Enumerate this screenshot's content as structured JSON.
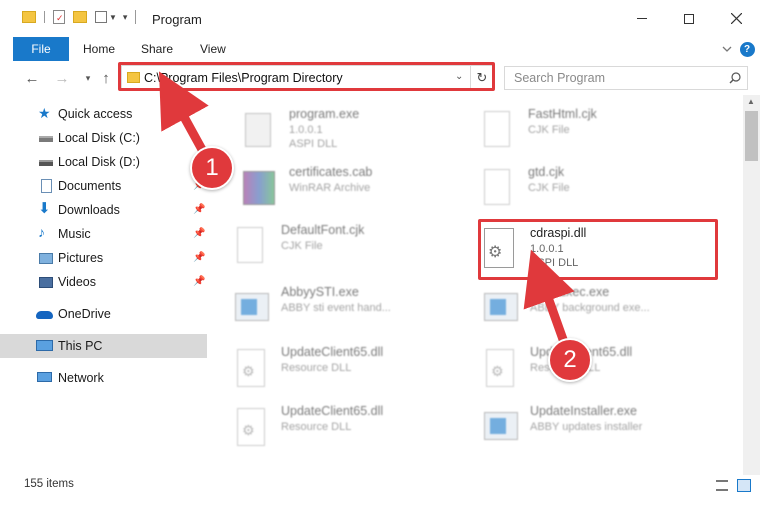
{
  "window": {
    "title": "Program",
    "controls": {
      "minimize_icon": "minimize-icon",
      "maximize_icon": "maximize-icon",
      "close_icon": "close-icon"
    }
  },
  "ribbon": {
    "file": "File",
    "tabs": [
      "Home",
      "Share",
      "View"
    ]
  },
  "address": {
    "path": "C:\\Program Files\\Program Directory"
  },
  "search": {
    "placeholder": "Search Program"
  },
  "sidebar": {
    "items": [
      {
        "label": "Quick access",
        "icon": "star-icon",
        "pinned": false
      },
      {
        "label": "Local Disk (C:)",
        "icon": "drive-icon",
        "pinned": false
      },
      {
        "label": "Local Disk (D:)",
        "icon": "drive-icon",
        "pinned": false
      },
      {
        "label": "Documents",
        "icon": "documents-icon",
        "pinned": true
      },
      {
        "label": "Downloads",
        "icon": "download-icon",
        "pinned": true
      },
      {
        "label": "Music",
        "icon": "music-icon",
        "pinned": true
      },
      {
        "label": "Pictures",
        "icon": "pictures-icon",
        "pinned": true
      },
      {
        "label": "Videos",
        "icon": "videos-icon",
        "pinned": true
      },
      {
        "label": "OneDrive",
        "icon": "cloud-icon",
        "pinned": false
      },
      {
        "label": "This PC",
        "icon": "computer-icon",
        "pinned": false,
        "selected": true
      },
      {
        "label": "Network",
        "icon": "network-icon",
        "pinned": false
      }
    ]
  },
  "files": [
    {
      "name": "program.exe",
      "line1": "1.0.0.1",
      "line2": "ASPI DLL",
      "icon": "exe-icon"
    },
    {
      "name": "FastHtml.cjk",
      "line1": "CJK File",
      "line2": "",
      "icon": "document-icon"
    },
    {
      "name": "certificates.cab",
      "line1": "WinRAR Archive",
      "line2": "",
      "icon": "archive-icon"
    },
    {
      "name": "gtd.cjk",
      "line1": "CJK File",
      "line2": "",
      "icon": "document-icon"
    },
    {
      "name": "DefaultFont.cjk",
      "line1": "CJK File",
      "line2": "",
      "icon": "document-icon"
    },
    {
      "name": "cdraspi.dll",
      "line1": "1.0.0.1",
      "line2": "ASPI DLL",
      "icon": "dll-icon"
    },
    {
      "name": "AbbyySTI.exe",
      "line1": "ABBY sti event hand...",
      "line2": "",
      "icon": "app-icon"
    },
    {
      "name": "BackExec.exe",
      "line1": "ABBY background exe...",
      "line2": "",
      "icon": "app-icon"
    },
    {
      "name": "UpdateClient65.dll",
      "line1": "Resource DLL",
      "line2": "",
      "icon": "dll-icon"
    },
    {
      "name": "UpdateClient65.dll",
      "line1": "Resource DLL",
      "line2": "",
      "icon": "dll-icon"
    },
    {
      "name": "UpdateClient65.dll",
      "line1": "Resource DLL",
      "line2": "",
      "icon": "dll-icon"
    },
    {
      "name": "UpdateInstaller.exe",
      "line1": "ABBY updates installer",
      "line2": "",
      "icon": "app-icon"
    }
  ],
  "status": {
    "items_count": "155 items"
  },
  "annotations": {
    "step1": "1",
    "step2": "2"
  },
  "colors": {
    "accent": "#1979ca",
    "highlight": "#e0393c"
  }
}
